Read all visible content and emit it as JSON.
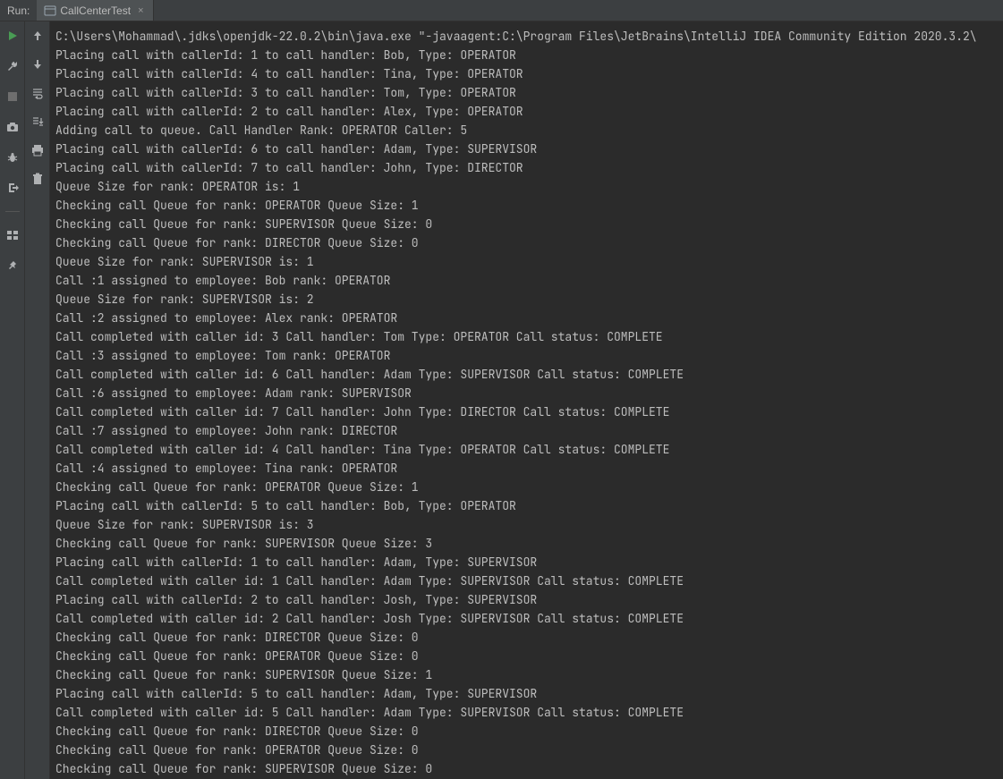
{
  "header": {
    "run_label": "Run:",
    "tab_title": "CallCenterTest",
    "close_glyph": "×"
  },
  "console_lines": [
    "C:\\Users\\Mohammad\\.jdks\\openjdk-22.0.2\\bin\\java.exe \"-javaagent:C:\\Program Files\\JetBrains\\IntelliJ IDEA Community Edition 2020.3.2\\",
    "Placing call with callerId: 1 to call handler: Bob, Type: OPERATOR",
    "Placing call with callerId: 4 to call handler: Tina, Type: OPERATOR",
    "Placing call with callerId: 3 to call handler: Tom, Type: OPERATOR",
    "Placing call with callerId: 2 to call handler: Alex, Type: OPERATOR",
    "Adding call to queue. Call Handler Rank: OPERATOR Caller: 5",
    "Placing call with callerId: 6 to call handler: Adam, Type: SUPERVISOR",
    "Placing call with callerId: 7 to call handler: John, Type: DIRECTOR",
    "Queue Size for rank: OPERATOR is: 1",
    "Checking call Queue for rank: OPERATOR Queue Size: 1",
    "Checking call Queue for rank: SUPERVISOR Queue Size: 0",
    "Checking call Queue for rank: DIRECTOR Queue Size: 0",
    "Queue Size for rank: SUPERVISOR is: 1",
    "Call :1 assigned to employee: Bob rank: OPERATOR",
    "Queue Size for rank: SUPERVISOR is: 2",
    "Call :2 assigned to employee: Alex rank: OPERATOR",
    "Call completed with caller id: 3 Call handler: Tom Type: OPERATOR Call status: COMPLETE",
    "Call :3 assigned to employee: Tom rank: OPERATOR",
    "Call completed with caller id: 6 Call handler: Adam Type: SUPERVISOR Call status: COMPLETE",
    "Call :6 assigned to employee: Adam rank: SUPERVISOR",
    "Call completed with caller id: 7 Call handler: John Type: DIRECTOR Call status: COMPLETE",
    "Call :7 assigned to employee: John rank: DIRECTOR",
    "Call completed with caller id: 4 Call handler: Tina Type: OPERATOR Call status: COMPLETE",
    "Call :4 assigned to employee: Tina rank: OPERATOR",
    "Checking call Queue for rank: OPERATOR Queue Size: 1",
    "Placing call with callerId: 5 to call handler: Bob, Type: OPERATOR",
    "Queue Size for rank: SUPERVISOR is: 3",
    "Checking call Queue for rank: SUPERVISOR Queue Size: 3",
    "Placing call with callerId: 1 to call handler: Adam, Type: SUPERVISOR",
    "Call completed with caller id: 1 Call handler: Adam Type: SUPERVISOR Call status: COMPLETE",
    "Placing call with callerId: 2 to call handler: Josh, Type: SUPERVISOR",
    "Call completed with caller id: 2 Call handler: Josh Type: SUPERVISOR Call status: COMPLETE",
    "Checking call Queue for rank: DIRECTOR Queue Size: 0",
    "Checking call Queue for rank: OPERATOR Queue Size: 0",
    "Checking call Queue for rank: SUPERVISOR Queue Size: 1",
    "Placing call with callerId: 5 to call handler: Adam, Type: SUPERVISOR",
    "Call completed with caller id: 5 Call handler: Adam Type: SUPERVISOR Call status: COMPLETE",
    "Checking call Queue for rank: DIRECTOR Queue Size: 0",
    "Checking call Queue for rank: OPERATOR Queue Size: 0",
    "Checking call Queue for rank: SUPERVISOR Queue Size: 0"
  ]
}
